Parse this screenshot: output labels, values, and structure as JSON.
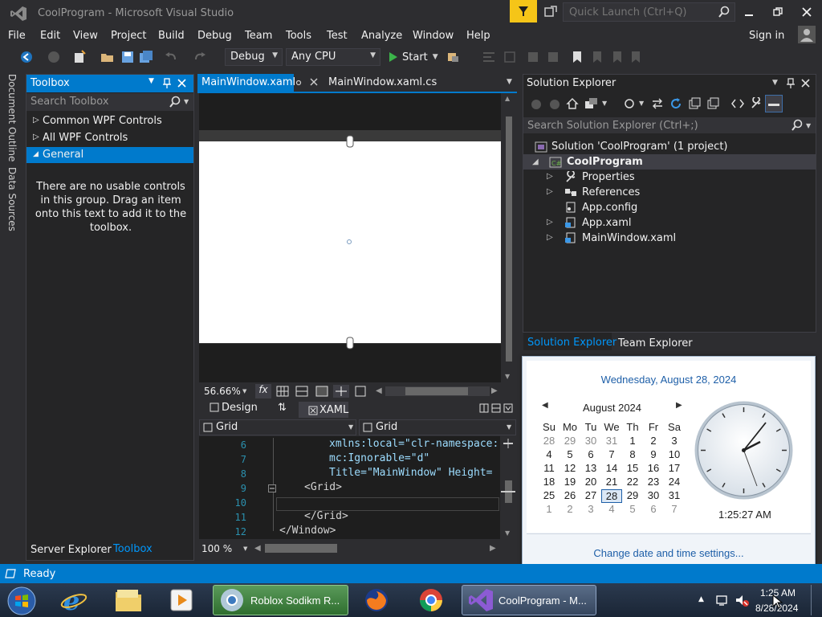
{
  "window": {
    "title": "CoolProgram - Microsoft Visual Studio",
    "quick_launch_placeholder": "Quick Launch (Ctrl+Q)",
    "sign_in": "Sign in"
  },
  "menu": [
    "File",
    "Edit",
    "View",
    "Project",
    "Build",
    "Debug",
    "Team",
    "Tools",
    "Test",
    "Analyze",
    "Window",
    "Help"
  ],
  "toolbar": {
    "config": "Debug",
    "platform": "Any CPU",
    "start": "Start"
  },
  "side_tabs": [
    "Document Outline",
    "Data Sources"
  ],
  "toolbox": {
    "title": "Toolbox",
    "search_placeholder": "Search Toolbox",
    "groups": [
      "Common WPF Controls",
      "All WPF Controls",
      "General"
    ],
    "empty_message": "There are no usable controls in this group. Drag an item onto this text to add it to the toolbox.",
    "bottom_tabs": [
      "Server Explorer",
      "Toolbox"
    ]
  },
  "editor": {
    "tabs": [
      "MainWindow.xaml",
      "MainWindow.xaml.cs"
    ],
    "zoom": "56.66%",
    "fx": "fx",
    "view_tabs": [
      "Design",
      "XAML"
    ],
    "swap": "⇅",
    "nav_left": "Grid",
    "nav_right": "Grid",
    "code_zoom": "100 %",
    "lines": [
      {
        "n": "6",
        "text": "xmlns:local=\"clr-namespace:"
      },
      {
        "n": "7",
        "text": "mc:Ignorable=\"d\""
      },
      {
        "n": "8",
        "text": "Title=\"MainWindow\" Height="
      },
      {
        "n": "9",
        "text": "<Grid>"
      },
      {
        "n": "10",
        "text": ""
      },
      {
        "n": "11",
        "text": "</Grid>"
      },
      {
        "n": "12",
        "text": "</Window>"
      }
    ]
  },
  "solution_explorer": {
    "title": "Solution Explorer",
    "search_placeholder": "Search Solution Explorer (Ctrl+;)",
    "solution": "Solution 'CoolProgram' (1 project)",
    "project": "CoolProgram",
    "items": [
      "Properties",
      "References",
      "App.config",
      "App.xaml",
      "MainWindow.xaml"
    ],
    "tabs": [
      "Solution Explorer",
      "Team Explorer"
    ]
  },
  "calendar": {
    "header": "Wednesday, August 28, 2024",
    "month": "August 2024",
    "dow": [
      "Su",
      "Mo",
      "Tu",
      "We",
      "Th",
      "Fr",
      "Sa"
    ],
    "weeks": [
      [
        "28",
        "29",
        "30",
        "31",
        "1",
        "2",
        "3"
      ],
      [
        "4",
        "5",
        "6",
        "7",
        "8",
        "9",
        "10"
      ],
      [
        "11",
        "12",
        "13",
        "14",
        "15",
        "16",
        "17"
      ],
      [
        "18",
        "19",
        "20",
        "21",
        "22",
        "23",
        "24"
      ],
      [
        "25",
        "26",
        "27",
        "28",
        "29",
        "30",
        "31"
      ],
      [
        "1",
        "2",
        "3",
        "4",
        "5",
        "6",
        "7"
      ]
    ],
    "selected_day": "28",
    "time": "1:25:27 AM",
    "link": "Change date and time settings..."
  },
  "status": {
    "text": "Ready"
  },
  "taskbar": {
    "items": [
      "Roblox Sodikm R...",
      "CoolProgram - M..."
    ],
    "time": "1:25 AM",
    "date": "8/28/2024"
  },
  "colors": {
    "accent": "#007acc",
    "selection": "#007acc",
    "link": "#1e5fa8"
  }
}
